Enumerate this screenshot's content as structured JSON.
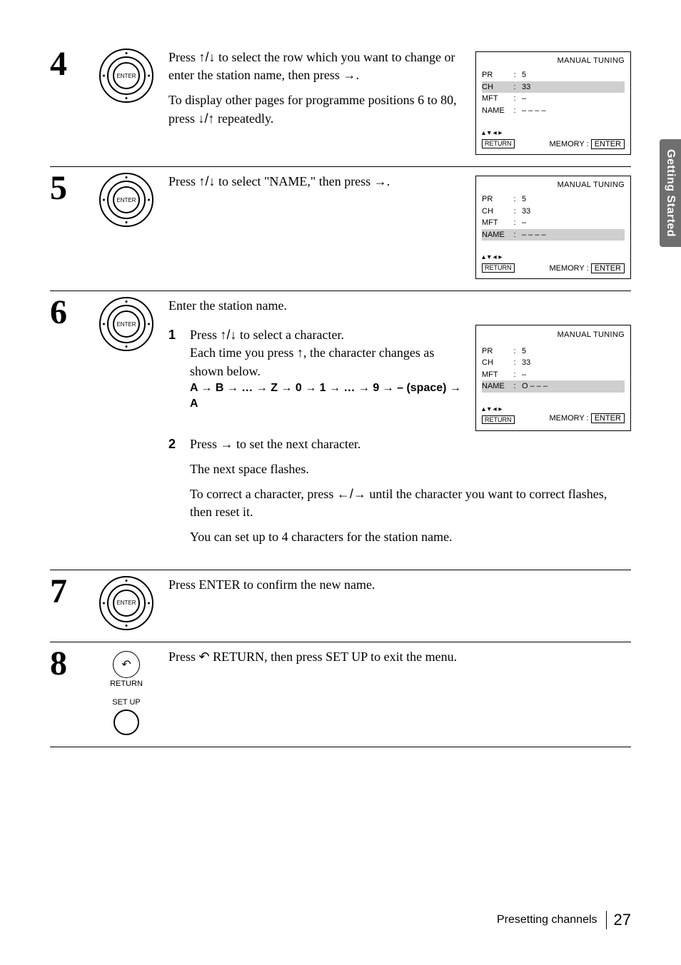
{
  "sideTab": "Getting Started",
  "glyph": {
    "up": "↑",
    "down": "↓",
    "left": "←",
    "right": "→",
    "return": "↺",
    "arrow": "→"
  },
  "enterLabel": "ENTER",
  "screens": {
    "title": "MANUAL TUNING",
    "rows": {
      "pr": "PR",
      "ch": "CH",
      "mft": "MFT",
      "name": "NAME"
    },
    "vals": {
      "pr": "5",
      "ch": "33",
      "mft": "–",
      "name4": "– – – –",
      "nameO": "O – – –"
    },
    "navArrows": "▴ ▾ ◂ ▸",
    "return": "RETURN",
    "memory": "MEMORY :",
    "enter": "ENTER"
  },
  "step4": {
    "num": "4",
    "p1a": "Press ",
    "p1b": " to select the row which you want to change or enter the station name, then press ",
    "p1c": ".",
    "p2a": "To display other pages for programme positions 6 to 80, press ",
    "p2b": " repeatedly."
  },
  "step5": {
    "num": "5",
    "p1a": "Press ",
    "p1b": " to select \"NAME,\" then press ",
    "p1c": "."
  },
  "step6": {
    "num": "6",
    "intro": "Enter the station name.",
    "s1": {
      "num": "1",
      "a": "Press ",
      "b": " to select a character.",
      "c": "Each time you press ",
      "d": ", the character changes as shown below."
    },
    "seq": "A → B → … → Z → 0 → 1 → … → 9 → – (space) → A",
    "s2": {
      "num": "2",
      "a": "Press ",
      "b": " to set the next character.",
      "c": "The next space flashes.",
      "d": "To correct a character, press ",
      "e": " until the character you want to correct flashes, then reset it.",
      "f": "You can set up to 4 characters for the station name."
    }
  },
  "step7": {
    "num": "7",
    "p": "Press ENTER to confirm the new name."
  },
  "step8": {
    "num": "8",
    "p1": "Press ",
    "p2": " RETURN, then press SET UP to exit the menu.",
    "retLabel": "RETURN",
    "setupLabel": "SET UP"
  },
  "footer": {
    "title": "Presetting channels",
    "page": "27"
  }
}
